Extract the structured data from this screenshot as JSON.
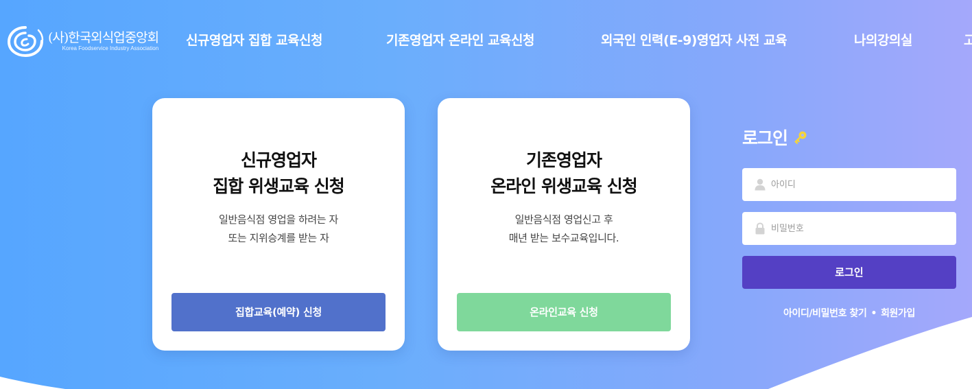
{
  "header": {
    "logo_ko": "(사)한국외식업중앙회",
    "logo_en": "Korea Foodservice Industry Association",
    "nav": [
      "신규영업자 집합 교육신청",
      "기존영업자 온라인 교육신청",
      "외국인 인력(E-9)영업자 사전 교육",
      "나의강의실",
      "고"
    ]
  },
  "cards": [
    {
      "title_line1": "신규영업자",
      "title_line2": "집합 위생교육 신청",
      "desc_line1": "일반음식점 영업을 하려는 자",
      "desc_line2": "또는 지위승계를 받는 자",
      "button": "집합교육(예약) 신청"
    },
    {
      "title_line1": "기존영업자",
      "title_line2": "온라인 위생교육 신청",
      "desc_line1": "일반음식점 영업신고 후",
      "desc_line2": "매년 받는 보수교육입니다.",
      "button": "온라인교육 신청"
    }
  ],
  "login": {
    "title": "로그인",
    "id_placeholder": "아이디",
    "pw_placeholder": "비밀번호",
    "button": "로그인",
    "find_link": "아이디/비밀번호 찾기",
    "separator": "•",
    "signup_link": "회원가입"
  },
  "colors": {
    "primary_button": "#5171cb",
    "online_button": "#7fd89b",
    "login_button": "#5440c4",
    "key_icon": "#f5d43a"
  },
  "icons": [
    "logo-swirl-icon",
    "key-icon",
    "user-icon",
    "lock-icon"
  ]
}
